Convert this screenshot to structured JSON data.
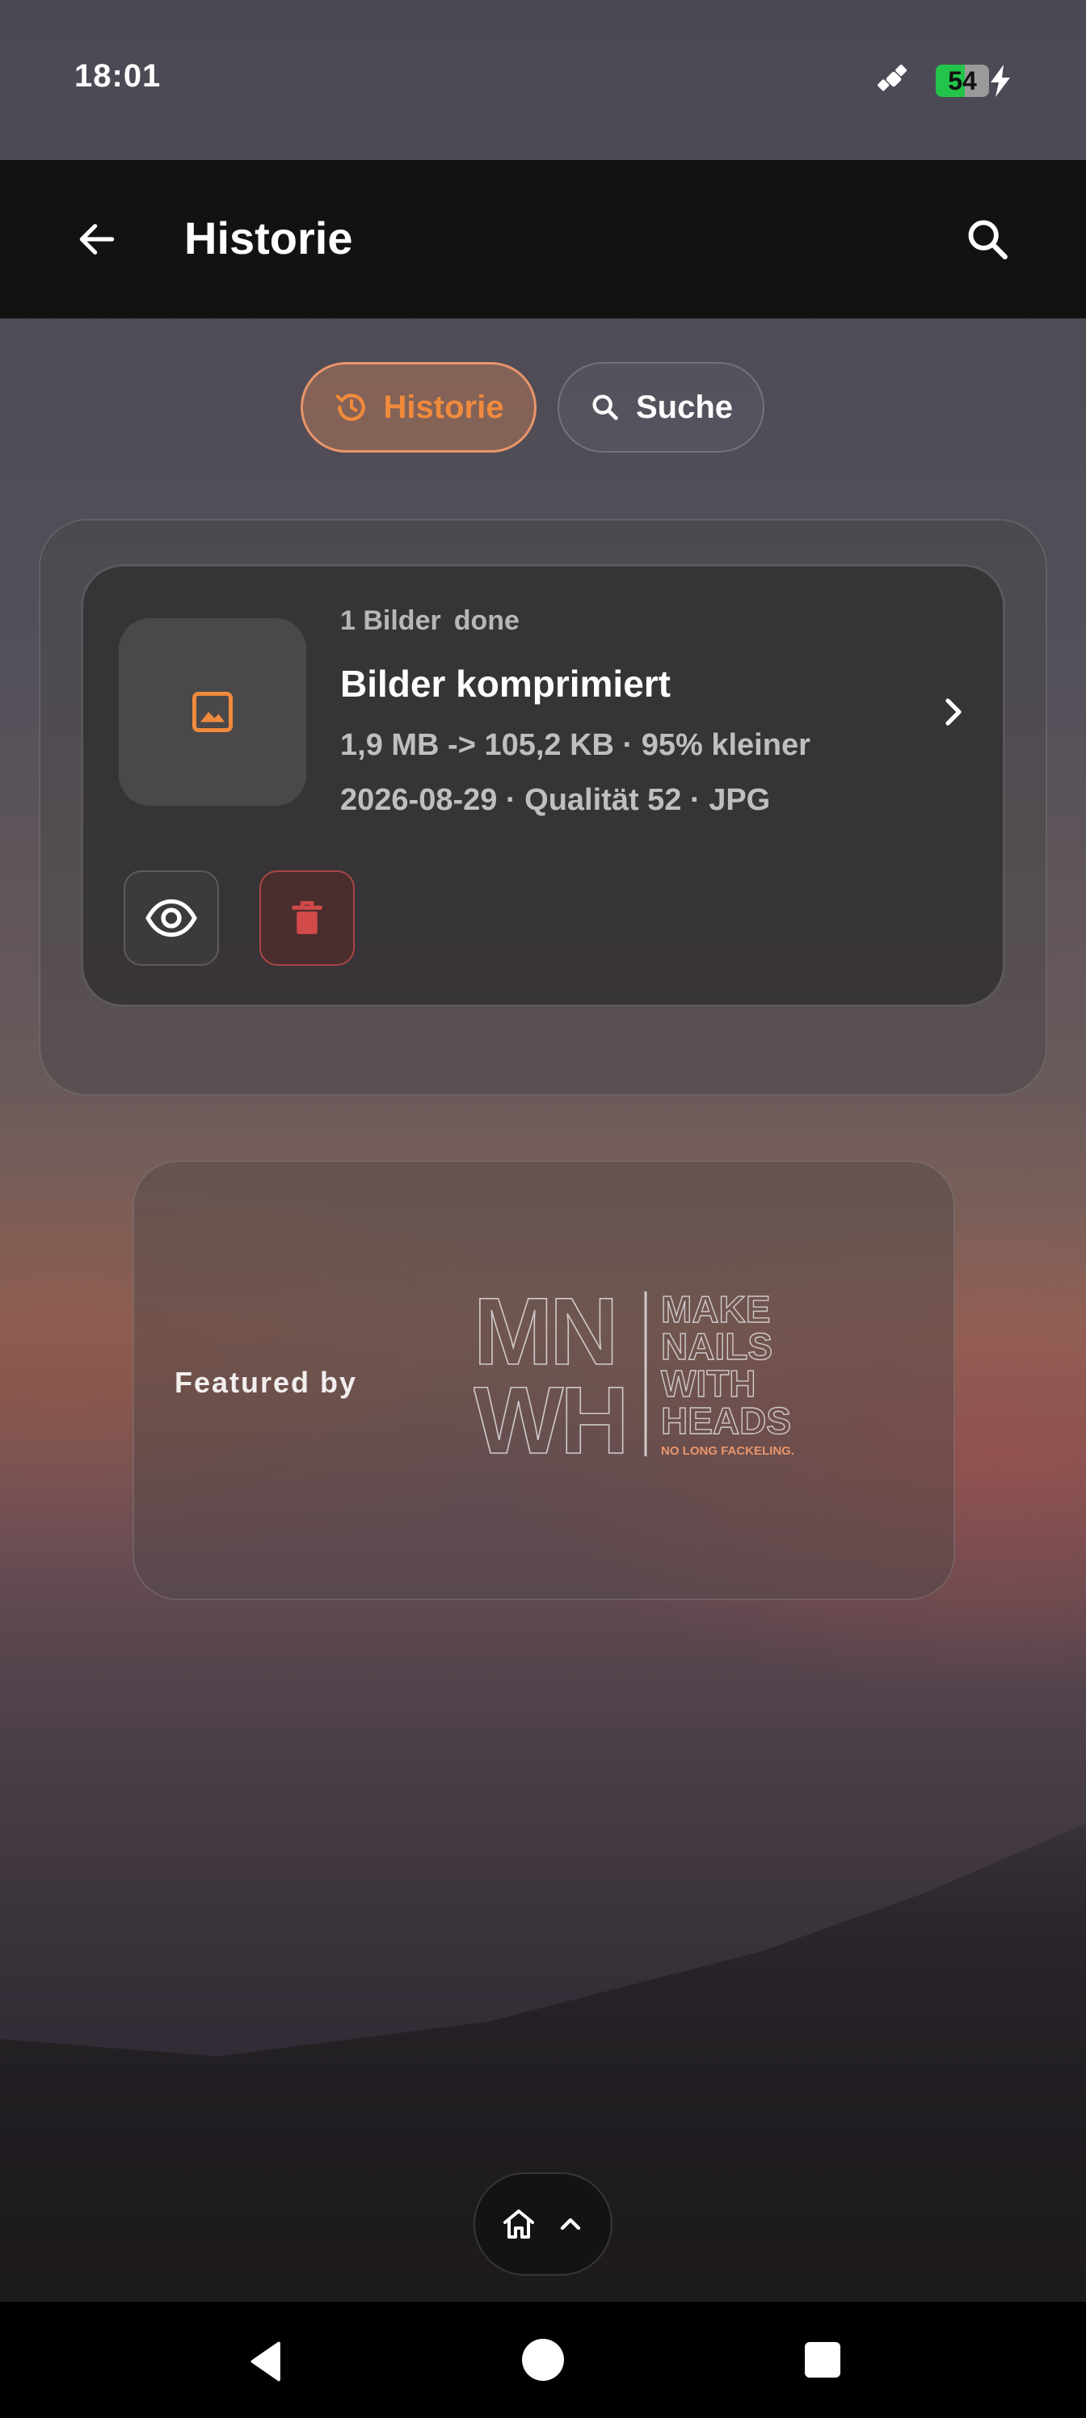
{
  "status_bar": {
    "time": "18:01",
    "battery_level": "54",
    "battery_fraction": 0.54,
    "icons": [
      "satellite-icon",
      "battery-icon",
      "charging-icon"
    ]
  },
  "app_bar": {
    "title": "Historie",
    "icons": [
      "back-arrow-icon",
      "search-icon"
    ]
  },
  "tabs": [
    {
      "label": "Historie",
      "icon": "history-icon",
      "active": true
    },
    {
      "label": "Suche",
      "icon": "search-icon",
      "active": false
    }
  ],
  "history_item": {
    "count": "1 Bilder",
    "status": "done",
    "title": "Bilder komprimiert",
    "size_info": "1,9 MB -> 105,2 KB · 95% kleiner",
    "details": "2026-08-29 · Qualität 52 · JPG",
    "icons": [
      "image-icon",
      "chevron-right-icon",
      "eye-icon",
      "trash-icon"
    ]
  },
  "featured": {
    "label": "Featured by",
    "logo_text": [
      "MN",
      "WH",
      "MAKE",
      "NAILS",
      "WITH",
      "HEADS",
      "NO LONG FACKELING."
    ]
  },
  "bottom_nav": {
    "icons": [
      "home-icon",
      "chevron-up-icon"
    ]
  },
  "system_nav": {
    "icons": [
      "nav-back-icon",
      "nav-home-icon",
      "nav-recents-icon"
    ]
  },
  "colors": {
    "accent": "#f08a3c",
    "danger": "#d24a4a",
    "appbar": "#121212"
  }
}
